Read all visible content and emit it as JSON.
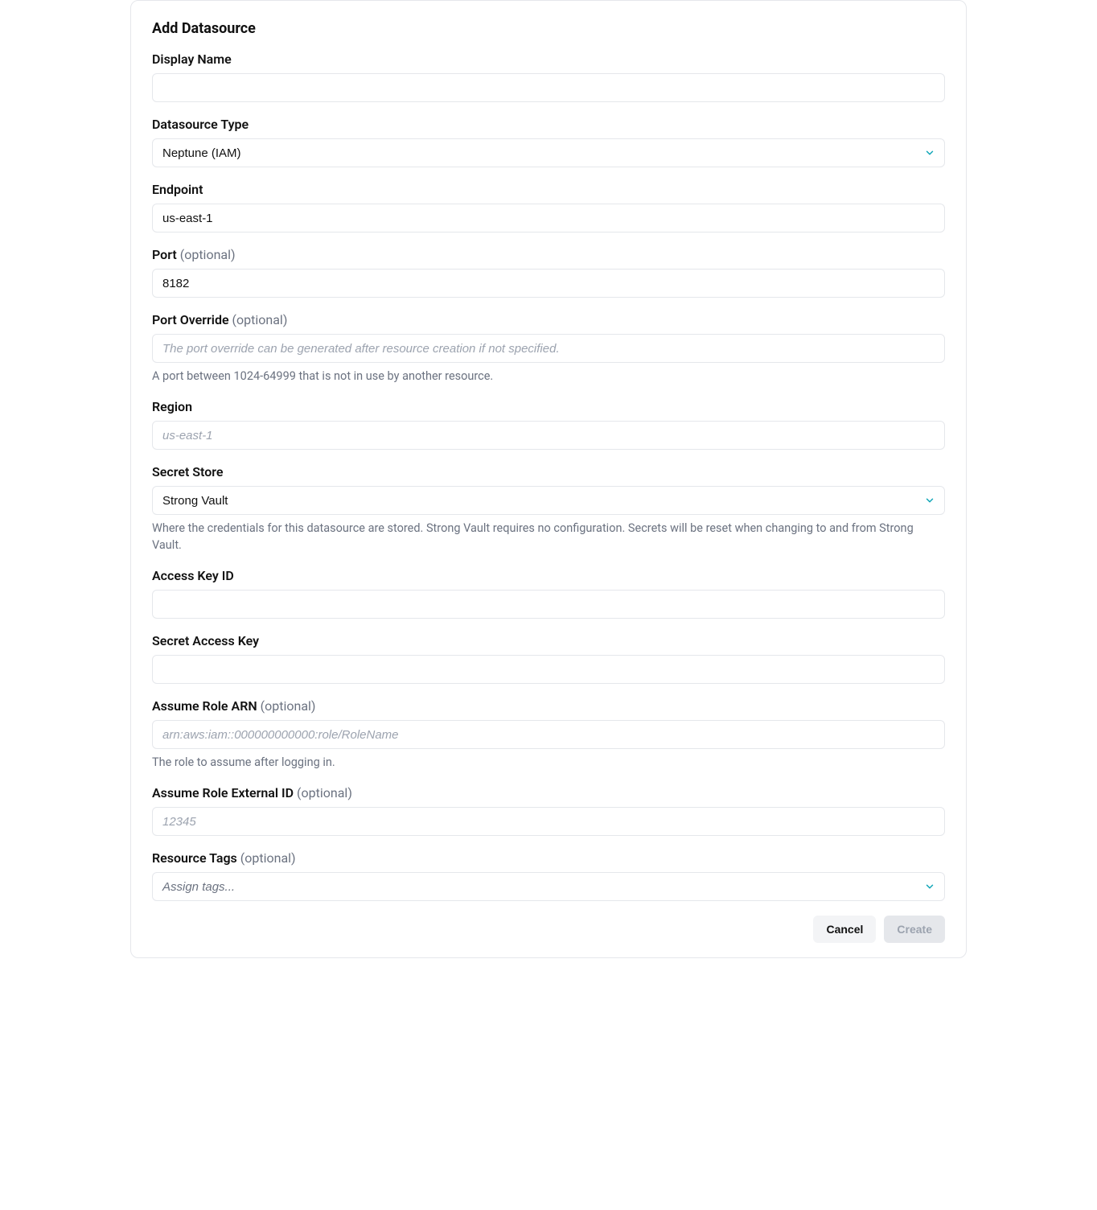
{
  "title": "Add Datasource",
  "fields": {
    "displayName": {
      "label": "Display Name",
      "value": ""
    },
    "datasourceType": {
      "label": "Datasource Type",
      "value": "Neptune (IAM)"
    },
    "endpoint": {
      "label": "Endpoint",
      "value": "us-east-1"
    },
    "port": {
      "label": "Port",
      "optional": "(optional)",
      "value": "8182"
    },
    "portOverride": {
      "label": "Port Override",
      "optional": "(optional)",
      "placeholder": "The port override can be generated after resource creation if not specified.",
      "help": "A port between 1024-64999 that is not in use by another resource."
    },
    "region": {
      "label": "Region",
      "placeholder": "us-east-1"
    },
    "secretStore": {
      "label": "Secret Store",
      "value": "Strong Vault",
      "help": "Where the credentials for this datasource are stored. Strong Vault requires no configuration. Secrets will be reset when changing to and from Strong Vault."
    },
    "accessKeyId": {
      "label": "Access Key ID",
      "value": ""
    },
    "secretAccessKey": {
      "label": "Secret Access Key",
      "value": ""
    },
    "assumeRoleArn": {
      "label": "Assume Role ARN",
      "optional": "(optional)",
      "placeholder": "arn:aws:iam::000000000000:role/RoleName",
      "help": "The role to assume after logging in."
    },
    "assumeRoleExternalId": {
      "label": "Assume Role External ID",
      "optional": "(optional)",
      "placeholder": "12345"
    },
    "resourceTags": {
      "label": "Resource Tags",
      "optional": "(optional)",
      "placeholder": "Assign tags..."
    }
  },
  "actions": {
    "cancel": "Cancel",
    "create": "Create"
  }
}
